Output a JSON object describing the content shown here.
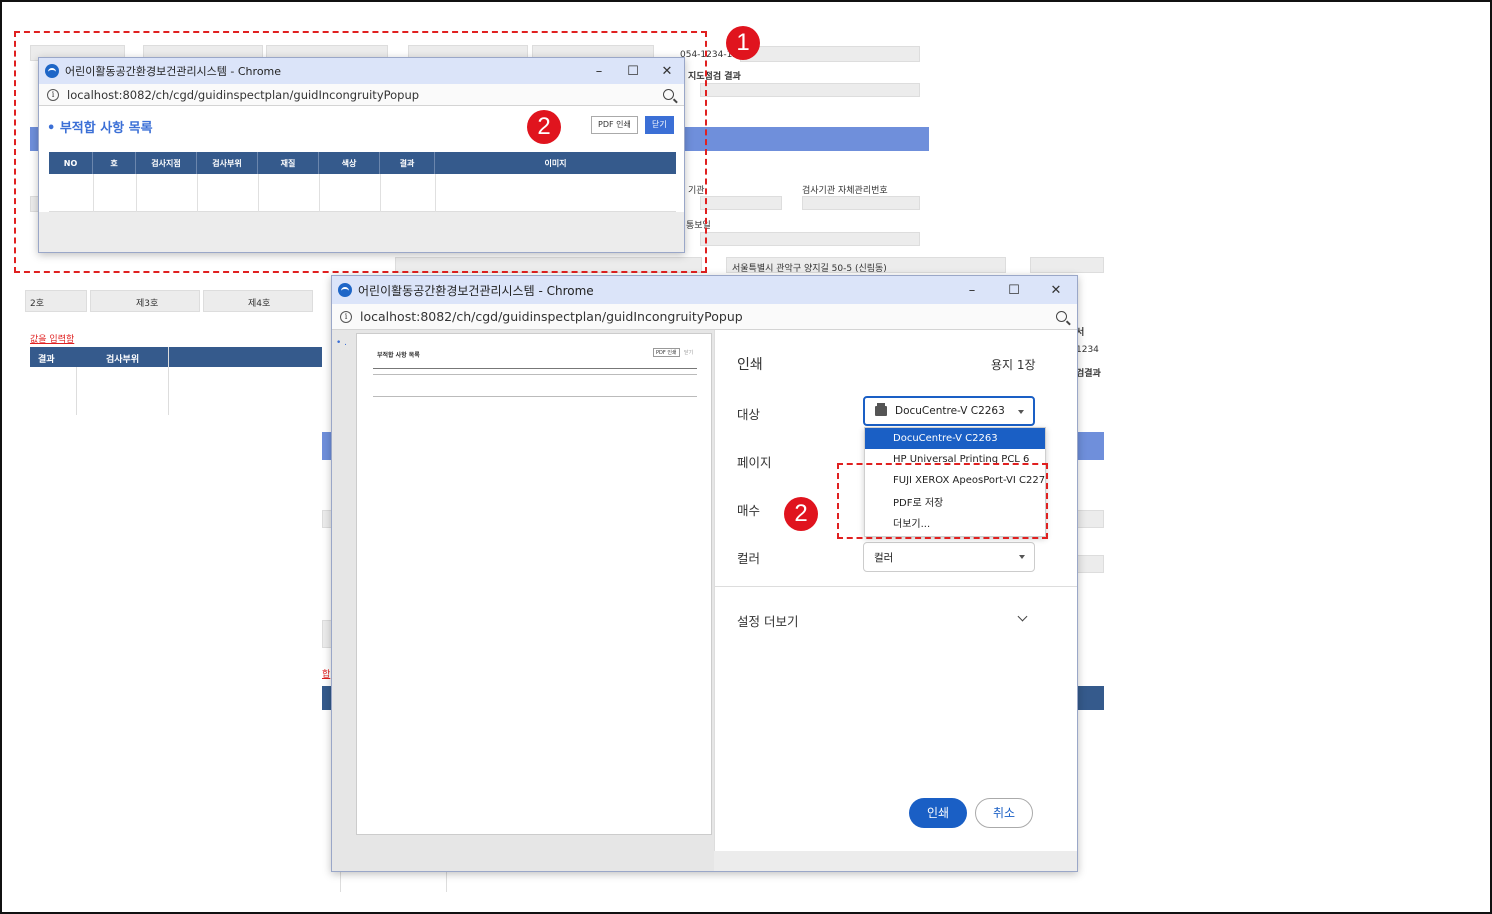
{
  "background_page": {
    "top_labels": [
      "054-1234-123",
      "지도점검 결과"
    ],
    "mid_labels": [
      "기관",
      "검사기관 자체관리번호",
      "통보일"
    ],
    "address": "서울특별시 관악구 양지길 50-5 (신림동)",
    "tabs": [
      "2호",
      "제3호",
      "제4호"
    ],
    "link_text": "값을 입력함",
    "table_headers": [
      "결과",
      "검사부위"
    ],
    "right_labels": [
      "서",
      "1234",
      "검결과"
    ],
    "left_red_text": "합"
  },
  "popup1": {
    "window_title": "어린이활동공간환경보건관리시스템 - Chrome",
    "url": "localhost:8082/ch/cgd/guidinspectplan/guidIncongruityPopup",
    "heading": "• 부적합 사항 목록",
    "pdf_button": "PDF 인쇄",
    "close_button": "닫기",
    "columns": [
      "NO",
      "호",
      "검사지점",
      "검사부위",
      "재질",
      "색상",
      "결과",
      "이미지"
    ]
  },
  "popup2": {
    "window_title": "어린이활동공간환경보건관리시스템 - Chrome",
    "url": "localhost:8082/ch/cgd/guidinspectplan/guidIncongruityPopup",
    "preview_heading": "부적합 사항 목록",
    "preview_pdf": "PDF 인쇄",
    "preview_close": "닫기",
    "bullet": "• ."
  },
  "print_dialog": {
    "title": "인쇄",
    "sheets": "용지 1장",
    "destination_label": "대상",
    "pages_label": "페이지",
    "copies_label": "매수",
    "color_label": "컬러",
    "color_value": "컬러",
    "destination_value": "DocuCentre-V C2263",
    "more_settings": "설정 더보기",
    "print_button": "인쇄",
    "cancel_button": "취소",
    "printers": [
      "DocuCentre-V C2263",
      "HP Universal Printing PCL 6",
      "FUJI XEROX ApeosPort-VI C2271",
      "PDF로 저장",
      "더보기..."
    ]
  },
  "annotations": {
    "badge1": "1",
    "badge2a": "2",
    "badge2b": "2"
  },
  "colors": {
    "accent": "#1a5fc5",
    "red": "#e0141e",
    "table_header": "#355a8c"
  }
}
